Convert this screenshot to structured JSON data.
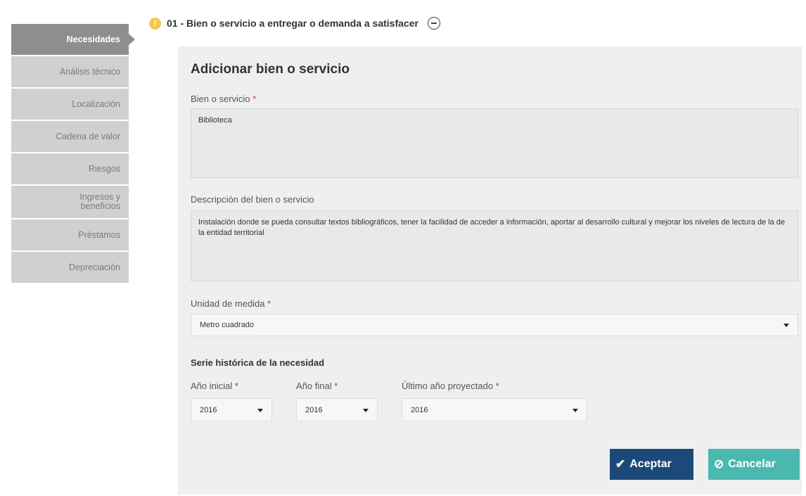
{
  "sidebar": {
    "items": [
      {
        "label": "Necesidades"
      },
      {
        "label": "Análisis técnico"
      },
      {
        "label": "Localización"
      },
      {
        "label": "Cadena de valor"
      },
      {
        "label": "Riesgos"
      },
      {
        "label": "Ingresos y beneficios"
      },
      {
        "label": "Préstamos"
      },
      {
        "label": "Depreciación"
      }
    ]
  },
  "header": {
    "alert_icon": "!",
    "title": "01 - Bien o servicio a entregar o demanda a satisfacer"
  },
  "form": {
    "title": "Adicionar bien o servicio",
    "required_mark": "*",
    "bien_label": "Bien o servicio",
    "bien_value": "Biblioteca",
    "descripcion_label": "Descripción del bien o servicio",
    "descripcion_value": "Instalación donde se pueda consultar textos bibliográficos, tener la facilidad de acceder a información, aportar al desarrollo cultural y mejorar los niveles de lectura de la de la entidad territorial",
    "unidad_label": "Unidad de medida",
    "unidad_value": "Metro cuadrado",
    "serie_title": "Serie histórica de la necesidad",
    "anio_inicial_label": "Año inicial",
    "anio_inicial_value": "2016",
    "anio_final_label": "Año final",
    "anio_final_value": "2016",
    "ultimo_anio_label": "Último año proyectado",
    "ultimo_anio_value": "2016"
  },
  "buttons": {
    "accept_label": "Aceptar",
    "cancel_label": "Cancelar",
    "accept_icon": "✔",
    "cancel_icon": "⊘"
  }
}
